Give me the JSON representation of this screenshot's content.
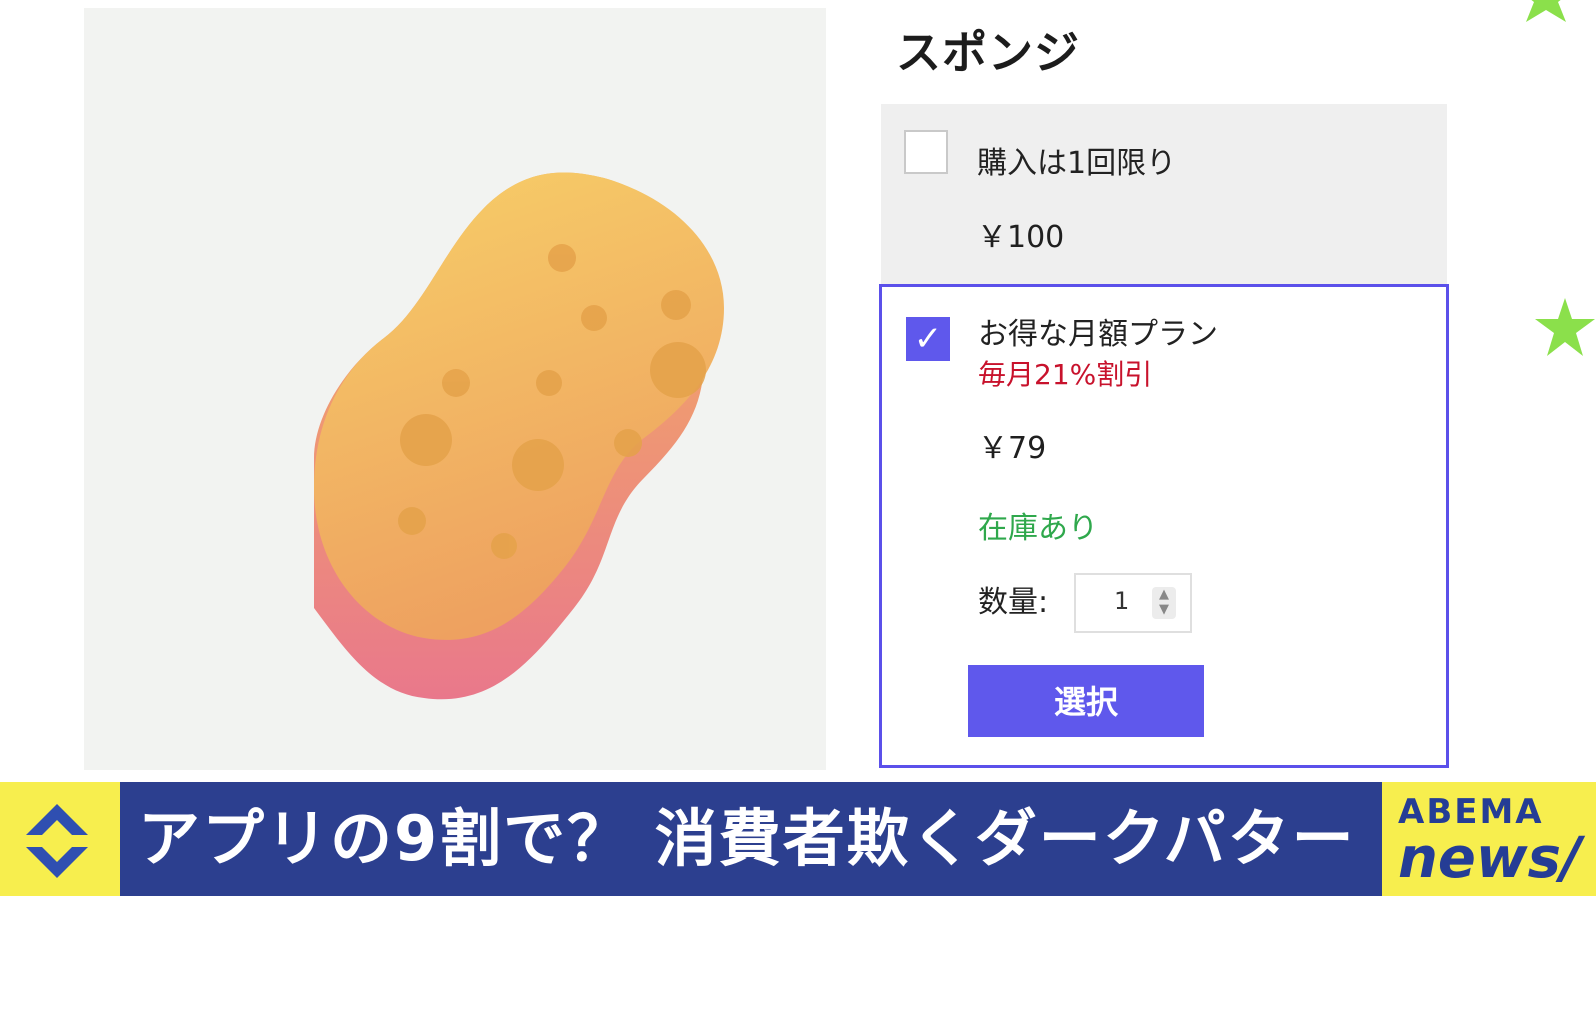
{
  "product": {
    "title": "スポンジ",
    "image_icon": "sponge-illustration"
  },
  "options": {
    "once": {
      "label": "購入は1回限り",
      "price": "￥100",
      "checked": false
    },
    "plan": {
      "label": "お得な月額プラン",
      "discount": "毎月21%割引",
      "price": "￥79",
      "stock": "在庫あり",
      "checked": true,
      "quantity_label": "数量:",
      "quantity_value": "1",
      "select_button": "選択"
    }
  },
  "banner": {
    "headline": "アプリの9割で？ 消費者欺くダークパターン",
    "logo_top": "ABEMA",
    "logo_bottom": "news/"
  },
  "colors": {
    "accent": "#5f58ec",
    "discount": "#c8122c",
    "stock": "#2fa84c",
    "banner_bg": "#2c3f8f",
    "banner_yellow": "#f7ee4e",
    "star_green": "#8be04b"
  }
}
